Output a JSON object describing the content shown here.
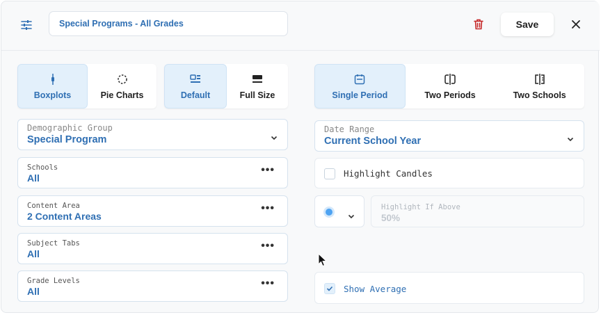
{
  "header": {
    "title_value": "Special Programs - All Grades",
    "save_label": "Save"
  },
  "view_toggle": {
    "options": [
      {
        "label": "Boxplots",
        "icon": "boxplot-icon",
        "active": true
      },
      {
        "label": "Pie Charts",
        "icon": "pie-chart-icon",
        "active": false
      }
    ]
  },
  "size_toggle": {
    "options": [
      {
        "label": "Default",
        "icon": "default-layout-icon",
        "active": true
      },
      {
        "label": "Full Size",
        "icon": "full-size-icon",
        "active": false
      }
    ]
  },
  "compare_toggle": {
    "options": [
      {
        "label": "Single Period",
        "icon": "calendar-icon",
        "active": true
      },
      {
        "label": "Two Periods",
        "icon": "split-compare-icon",
        "active": false
      },
      {
        "label": "Two Schools",
        "icon": "split-compare-icon",
        "active": false
      }
    ]
  },
  "filters": {
    "demographic": {
      "label": "Demographic Group",
      "value": "Special Program"
    },
    "schools": {
      "label": "Schools",
      "value": "All"
    },
    "content_area": {
      "label": "Content Area",
      "value": "2 Content Areas"
    },
    "subject_tabs": {
      "label": "Subject Tabs",
      "value": "All"
    },
    "grade_levels": {
      "label": "Grade Levels",
      "value": "All"
    },
    "more_symbol": "•••"
  },
  "options": {
    "date_range": {
      "label": "Date Range",
      "value": "Current School Year"
    },
    "highlight_candles": {
      "label": "Highlight Candles",
      "checked": false
    },
    "highlight_if_above": {
      "label": "Highlight If Above",
      "placeholder": "50%"
    },
    "show_average": {
      "label": "Show Average",
      "checked": true
    }
  },
  "colors": {
    "accent": "#2f6fb3",
    "active_bg": "#e3f0fb",
    "delete": "#c62828",
    "dot": "#4ea3f2"
  }
}
